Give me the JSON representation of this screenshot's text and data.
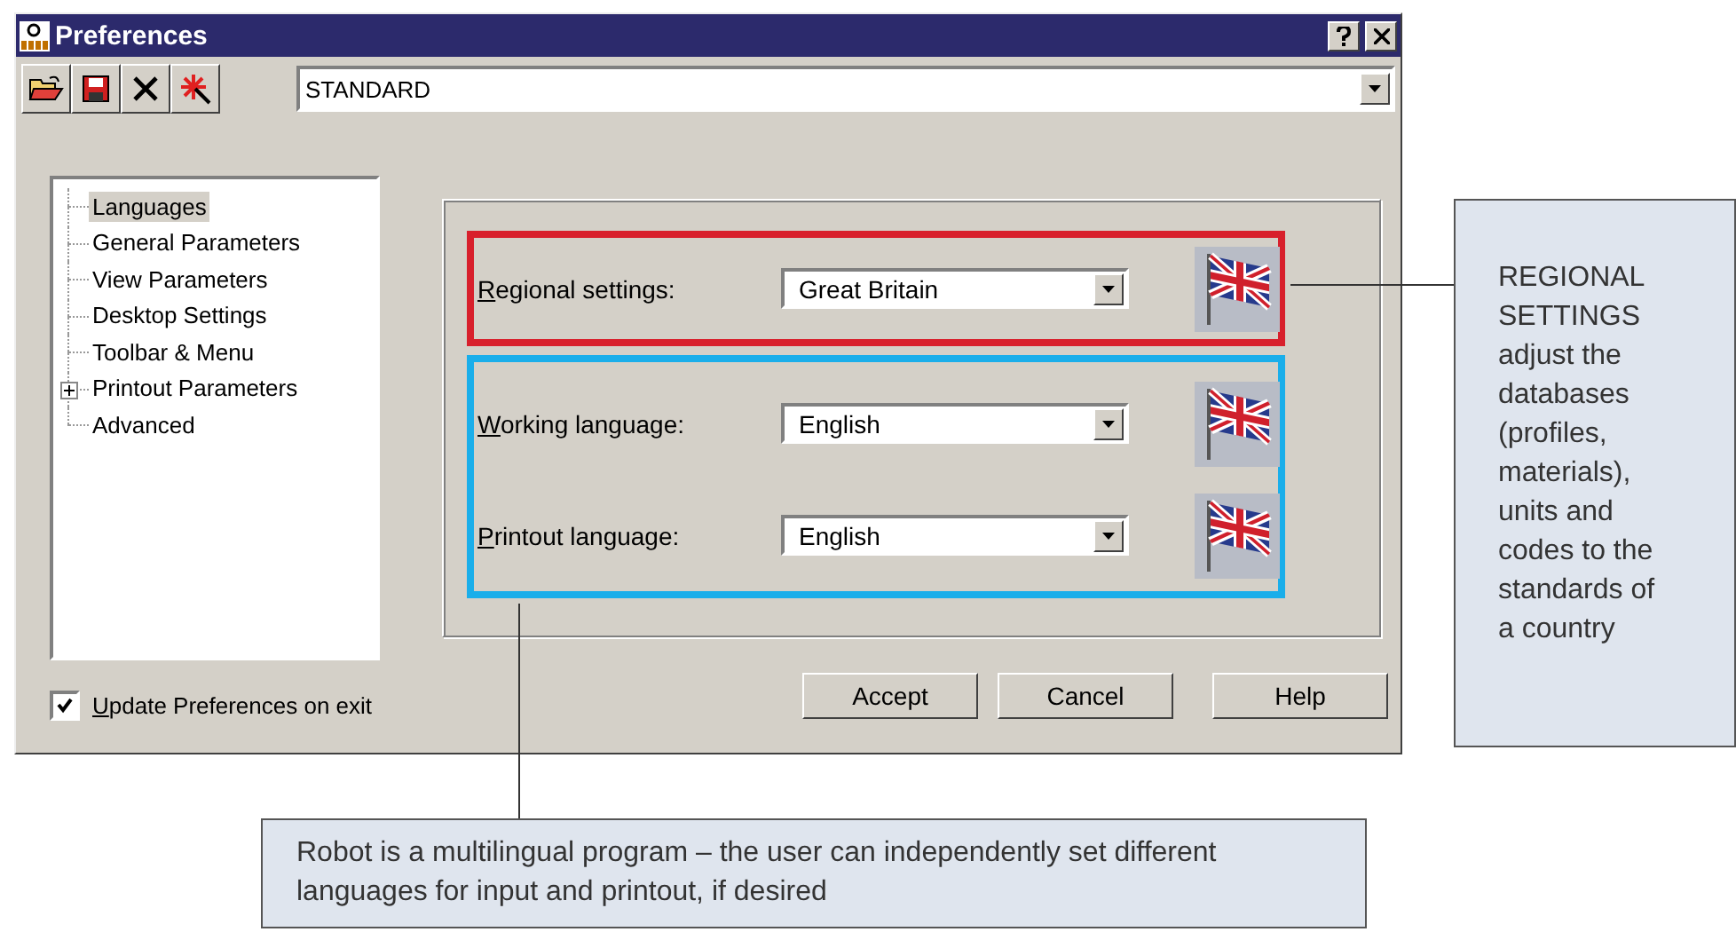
{
  "window": {
    "title": "Preferences"
  },
  "toolbar": {
    "profile": "STANDARD"
  },
  "tree": [
    {
      "label": "Languages",
      "selected": true,
      "expandable": false
    },
    {
      "label": "General Parameters",
      "selected": false,
      "expandable": false
    },
    {
      "label": "View Parameters",
      "selected": false,
      "expandable": false
    },
    {
      "label": "Desktop Settings",
      "selected": false,
      "expandable": false
    },
    {
      "label": "Toolbar & Menu",
      "selected": false,
      "expandable": false
    },
    {
      "label": "Printout Parameters",
      "selected": false,
      "expandable": true
    },
    {
      "label": "Advanced",
      "selected": false,
      "expandable": false
    }
  ],
  "groups": [
    {
      "color": "#d8202c",
      "rows": [
        {
          "label": "Regional settings:",
          "value": "Great Britain"
        }
      ]
    },
    {
      "color": "#1aaeea",
      "rows": [
        {
          "label": "Working language:",
          "value": "English"
        },
        {
          "label": "Printout language:",
          "value": "English"
        }
      ]
    }
  ],
  "checkbox": {
    "label": "Update Preferences on exit",
    "checked": true
  },
  "buttons": [
    "Accept",
    "Cancel",
    "Help"
  ],
  "callouts": [
    {
      "kind": "side",
      "text": "REGIONAL SETTINGS adjust the databases (profiles, materials), units and codes to the standards of a country"
    },
    {
      "kind": "bottom",
      "text": "Robot is a multilingual program – the user can independently set different languages for input and printout, if desired"
    }
  ]
}
